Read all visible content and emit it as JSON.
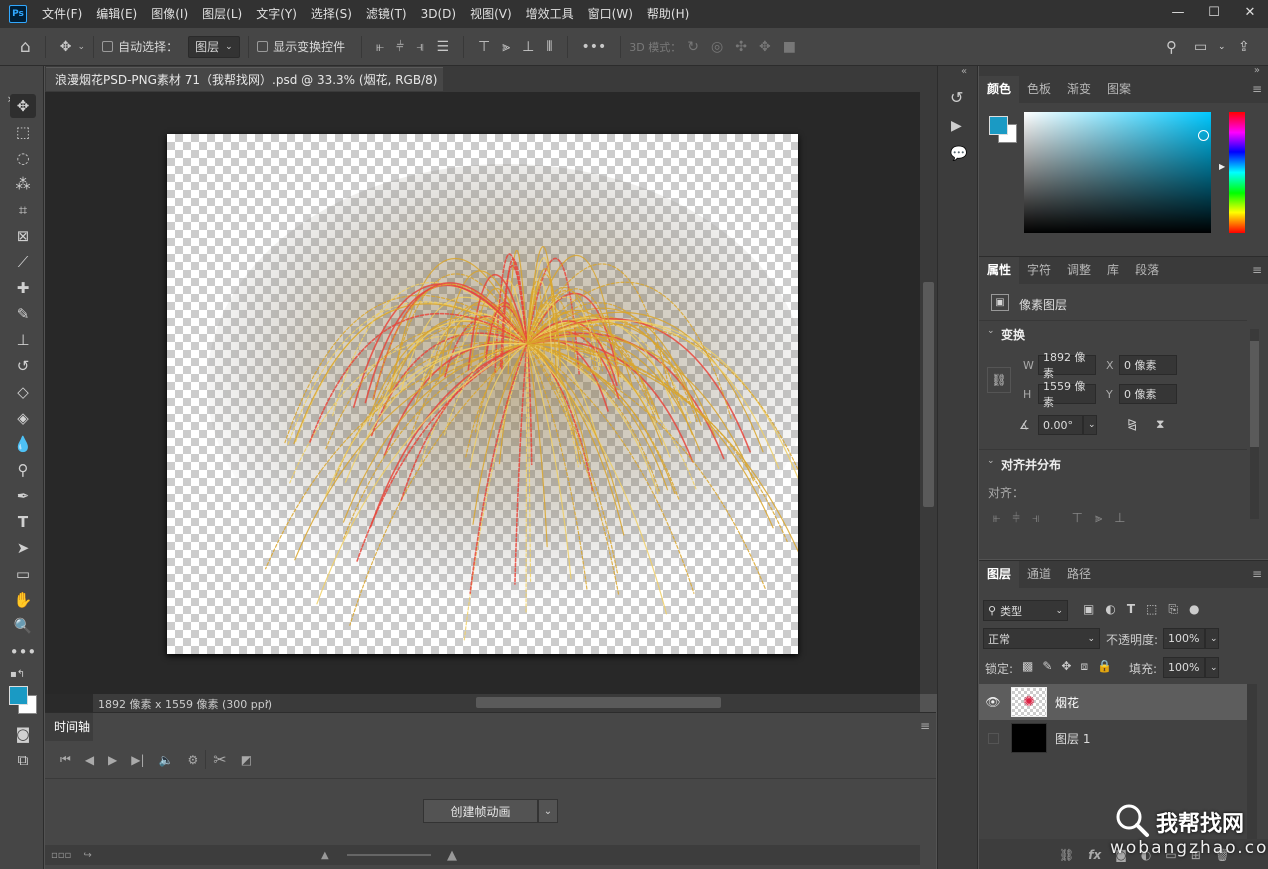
{
  "menubar": {
    "logo": "Ps",
    "items": [
      "文件(F)",
      "编辑(E)",
      "图像(I)",
      "图层(L)",
      "文字(Y)",
      "选择(S)",
      "滤镜(T)",
      "3D(D)",
      "视图(V)",
      "增效工具",
      "窗口(W)",
      "帮助(H)"
    ],
    "window_buttons": [
      "—",
      "☐",
      "✕"
    ]
  },
  "options": {
    "auto_select_label": "自动选择：",
    "layer_select": "图层",
    "show_transform_label": "显示变换控件",
    "more": "•••",
    "mode_3d_label": "3D 模式："
  },
  "document": {
    "tab_title": "浪漫烟花PSD-PNG素材 71（我帮找网）.psd @ 33.3% (烟花, RGB/8) *",
    "close": "×",
    "status_text": "1892 像素 x 1559 像素 (300 ppi)",
    "status_arrow": "›"
  },
  "timeline": {
    "title": "时间轴",
    "create_button": "创建帧动画"
  },
  "color_panel": {
    "tabs": [
      "颜色",
      "色板",
      "渐变",
      "图案"
    ],
    "foreground": "#1a9ac4",
    "background": "#ffffff",
    "hue_color": "#00c8ff"
  },
  "properties": {
    "tabs": [
      "属性",
      "字符",
      "调整",
      "库",
      "段落"
    ],
    "type_label": "像素图层",
    "transform_title": "变换",
    "w_label": "W",
    "w_value": "1892 像素",
    "h_label": "H",
    "h_value": "1559 像素",
    "x_label": "X",
    "x_value": "0 像素",
    "y_label": "Y",
    "y_value": "0 像素",
    "angle_value": "0.00°",
    "align_title": "对齐并分布",
    "align_label": "对齐："
  },
  "layers": {
    "tabs": [
      "图层",
      "通道",
      "路径"
    ],
    "filter_type": "类型",
    "blend_mode": "正常",
    "opacity_label": "不透明度:",
    "opacity_value": "100%",
    "lock_label": "锁定:",
    "fill_label": "填充:",
    "fill_value": "100%",
    "items": [
      {
        "name": "烟花",
        "visible": true,
        "selected": true
      },
      {
        "name": "图层 1",
        "visible": false,
        "selected": false
      }
    ],
    "fx_label": "fx"
  },
  "watermark": {
    "name": "我帮找网",
    "url": "wobangzhao.com"
  }
}
